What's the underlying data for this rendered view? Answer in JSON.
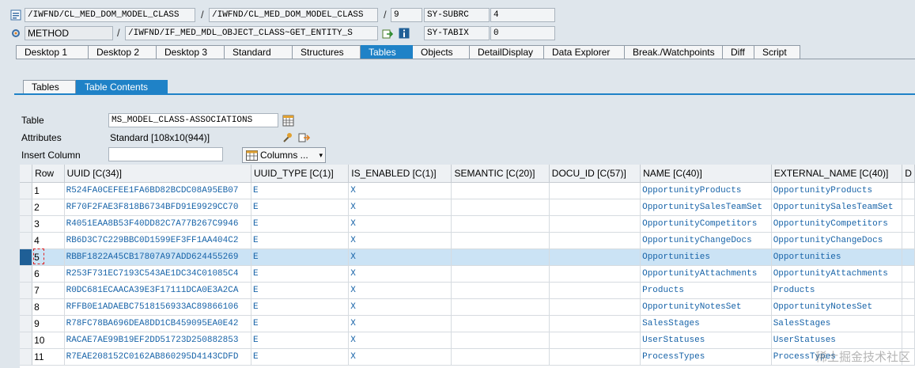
{
  "header": {
    "row1": {
      "field1": "/IWFND/CL_MED_DOM_MODEL_CLASS",
      "field2": "/IWFND/CL_MED_DOM_MODEL_CLASS",
      "line": "9",
      "var_name": "SY-SUBRC",
      "var_value": "4"
    },
    "row2": {
      "kind": "METHOD",
      "method": "/IWFND/IF_MED_MDL_OBJECT_CLASS~GET_ENTITY_S",
      "var_name": "SY-TABIX",
      "var_value": "0"
    },
    "separator": "/"
  },
  "main_tabs": [
    "Desktop 1",
    "Desktop 2",
    "Desktop 3",
    "Standard",
    "Structures",
    "Tables",
    "Objects",
    "DetailDisplay",
    "Data Explorer",
    "Break./Watchpoints",
    "Diff",
    "Script"
  ],
  "active_main_tab": "Tables",
  "sub_tabs": [
    "Tables",
    "Table Contents"
  ],
  "active_sub_tab": "Table Contents",
  "form": {
    "table_label": "Table",
    "table_value": "MS_MODEL_CLASS-ASSOCIATIONS",
    "attributes_label": "Attributes",
    "attributes_value": "Standard [108x10(944)]",
    "insert_column_label": "Insert Column",
    "insert_column_value": "",
    "columns_button": "Columns ..."
  },
  "table": {
    "headers": [
      "Row",
      "UUID [C(34)]",
      "UUID_TYPE [C(1)]",
      "IS_ENABLED [C(1)]",
      "SEMANTIC [C(20)]",
      "DOCU_ID [C(57)]",
      "NAME [C(40)]",
      "EXTERNAL_NAME [C(40)]",
      "D"
    ],
    "rows": [
      [
        "1",
        "R524FA0CEFEE1FA6BD82BCDC08A95EB07",
        "E",
        "X",
        "",
        "",
        "OpportunityProducts",
        "OpportunityProducts",
        ""
      ],
      [
        "2",
        "RF70F2FAE3F818B6734BFD91E9929CC70",
        "E",
        "X",
        "",
        "",
        "OpportunitySalesTeamSet",
        "OpportunitySalesTeamSet",
        ""
      ],
      [
        "3",
        "R4051EAA8B53F40DD82C7A77B267C9946",
        "E",
        "X",
        "",
        "",
        "OpportunityCompetitors",
        "OpportunityCompetitors",
        ""
      ],
      [
        "4",
        "RB6D3C7C229BBC0D1599EF3FF1AA404C2",
        "E",
        "X",
        "",
        "",
        "OpportunityChangeDocs",
        "OpportunityChangeDocs",
        ""
      ],
      [
        "5",
        "RBBF1822A45CB17807A97ADD624455269",
        "E",
        "X",
        "",
        "",
        "Opportunities",
        "Opportunities",
        ""
      ],
      [
        "6",
        "R253F731EC7193C543AE1DC34C01085C4",
        "E",
        "X",
        "",
        "",
        "OpportunityAttachments",
        "OpportunityAttachments",
        ""
      ],
      [
        "7",
        "R0DC681ECAACA39E3F17111DCA0E3A2CA",
        "E",
        "X",
        "",
        "",
        "Products",
        "Products",
        ""
      ],
      [
        "8",
        "RFFB0E1ADAEBC7518156933AC89866106",
        "E",
        "X",
        "",
        "",
        "OpportunityNotesSet",
        "OpportunityNotesSet",
        ""
      ],
      [
        "9",
        "R78FC78BA696DEA8DD1CB459095EA0E42",
        "E",
        "X",
        "",
        "",
        "SalesStages",
        "SalesStages",
        ""
      ],
      [
        "10",
        "RACAE7AE99B19EF2DD51723D250882853",
        "E",
        "X",
        "",
        "",
        "UserStatuses",
        "UserStatuses",
        ""
      ],
      [
        "11",
        "R7EAE208152C0162AB860295D4143CDFD",
        "E",
        "X",
        "",
        "",
        "ProcessTypes",
        "ProcessTypes",
        ""
      ]
    ],
    "highlighted_row": "5"
  },
  "watermark": "稀土掘金技术社区",
  "colors": {
    "accent": "#1f82c7",
    "link_text": "#1763a8",
    "highlight_row": "#cbe3f5"
  }
}
